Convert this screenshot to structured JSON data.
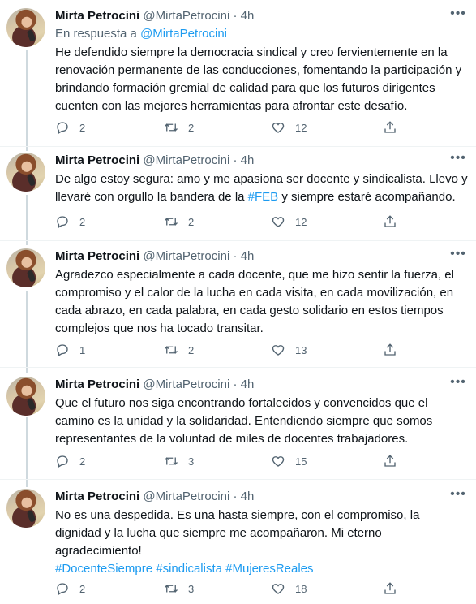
{
  "author": {
    "name": "Mirta Petrocini",
    "handle": "@MirtaPetrocini",
    "dot": "·"
  },
  "tweets": [
    {
      "time": "4h",
      "reply_prefix": "En respuesta a",
      "reply_handle": "@MirtaPetrocini",
      "lines": [
        "He defendido siempre la democracia sindical y creo fervientemente en la",
        "renovación permanente de las conducciones, fomentando la participación y",
        "brindando formación gremial de calidad para que los futuros dirigentes",
        "cuenten con las mejores herramientas para afrontar este desafío."
      ],
      "replies": "2",
      "retweets": "2",
      "likes": "12"
    },
    {
      "time": "4h",
      "lines_rich": {
        "l1": "De algo estoy segura: amo y me apasiona ser docente y sindicalista. Llevo y",
        "l2_before": "llevaré con orgullo la bandera de la ",
        "l2_tag": "#FEB",
        "l2_after": " y siempre estaré acompañando."
      },
      "replies": "2",
      "retweets": "2",
      "likes": "12"
    },
    {
      "time": "4h",
      "lines": [
        "Agradezco especialmente a cada docente, que me hizo sentir la fuerza, el",
        "compromiso y el calor de la lucha en cada visita, en cada movilización, en",
        "cada abrazo, en cada palabra, en cada gesto solidario en estos tiempos",
        "complejos que nos ha tocado transitar."
      ],
      "replies": "1",
      "retweets": "2",
      "likes": "13"
    },
    {
      "time": "4h",
      "lines": [
        "Que el futuro nos siga encontrando fortalecidos y convencidos que el",
        "camino es la unidad y la solidaridad. Entendiendo siempre que somos",
        "representantes de la voluntad de miles de docentes trabajadores."
      ],
      "replies": "2",
      "retweets": "3",
      "likes": "15"
    },
    {
      "time": "4h",
      "lines": [
        "No es una despedida. Es una hasta siempre, con el compromiso, la",
        "dignidad y la lucha que siempre me acompañaron. Mi eterno",
        "agradecimiento!"
      ],
      "hashtags": [
        "#DocenteSiempre",
        "#sindicalista",
        "#MujeresReales"
      ],
      "replies": "2",
      "retweets": "3",
      "likes": "18"
    }
  ],
  "icons": {
    "reply": "speech-bubble",
    "retweet": "two-arrows-loop",
    "like": "heart-outline",
    "share": "arrow-up-from-tray",
    "more": "three-dots"
  },
  "colors": {
    "accent": "#1d9bf0",
    "muted": "#536471",
    "text": "#0f1419",
    "thread": "#cfd9de"
  }
}
